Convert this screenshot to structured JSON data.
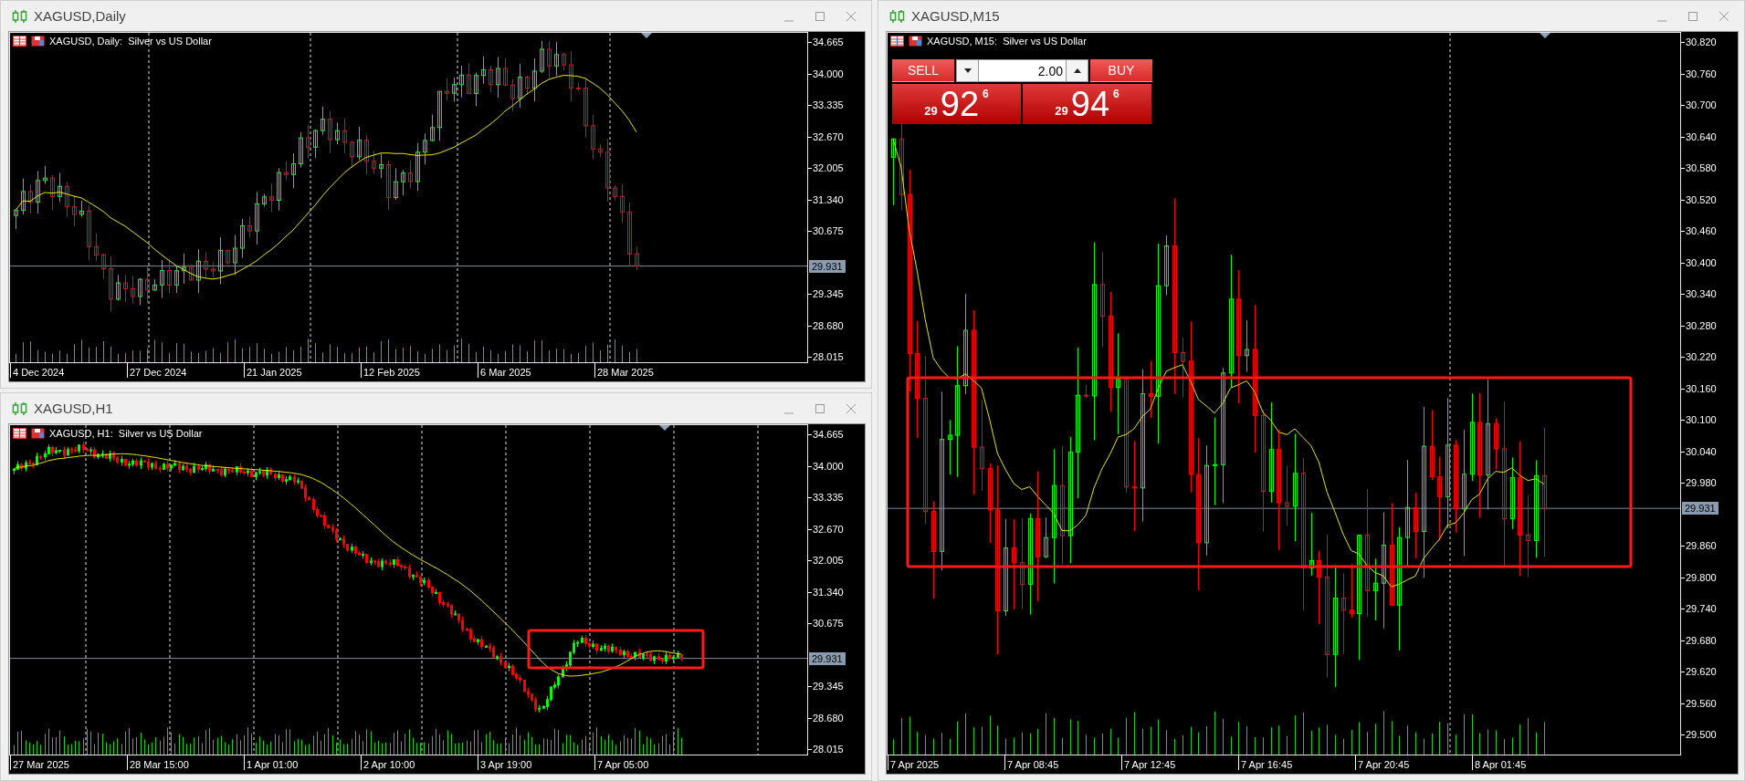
{
  "windows": [
    {
      "title": "XAGUSD,Daily",
      "chart_label": "XAGUSD, Daily:  Silver vs US Dollar",
      "price_ticks": [
        "34.665",
        "34.000",
        "33.335",
        "32.670",
        "32.005",
        "31.340",
        "30.675",
        "29.345",
        "28.680",
        "28.015"
      ],
      "current_price": "29.931",
      "time_labels": [
        "4 Dec 2024",
        "27 Dec 2024",
        "21 Jan 2025",
        "12 Feb 2025",
        "6 Mar 2025",
        "28 Mar 2025"
      ]
    },
    {
      "title": "XAGUSD,H1",
      "chart_label": "XAGUSD, H1:  Silver vs US Dollar",
      "price_ticks": [
        "34.665",
        "34.000",
        "33.335",
        "32.670",
        "32.005",
        "31.340",
        "30.675",
        "29.345",
        "28.680",
        "28.015"
      ],
      "current_price": "29.931",
      "time_labels": [
        "27 Mar 2025",
        "28 Mar 15:00",
        "1 Apr 01:00",
        "2 Apr 10:00",
        "3 Apr 19:00",
        "7 Apr 05:00"
      ]
    },
    {
      "title": "XAGUSD,M15",
      "chart_label": "XAGUSD, M15:  Silver vs US Dollar",
      "price_ticks": [
        "30.820",
        "30.760",
        "30.700",
        "30.640",
        "30.580",
        "30.520",
        "30.460",
        "30.400",
        "30.340",
        "30.280",
        "30.220",
        "30.160",
        "30.100",
        "30.040",
        "29.980",
        "29.860",
        "29.800",
        "29.740",
        "29.680",
        "29.620",
        "29.560",
        "29.500"
      ],
      "current_price": "29.931",
      "time_labels": [
        "7 Apr 2025",
        "7 Apr 08:45",
        "7 Apr 12:45",
        "7 Apr 16:45",
        "7 Apr 20:45",
        "8 Apr 01:45"
      ],
      "trade_panel": {
        "sell_label": "SELL",
        "buy_label": "BUY",
        "lot": "2.00",
        "bid": {
          "big_figure": "29",
          "pips": "92",
          "point": "6"
        },
        "ask": {
          "big_figure": "29",
          "pips": "94",
          "point": "6"
        }
      }
    }
  ]
}
